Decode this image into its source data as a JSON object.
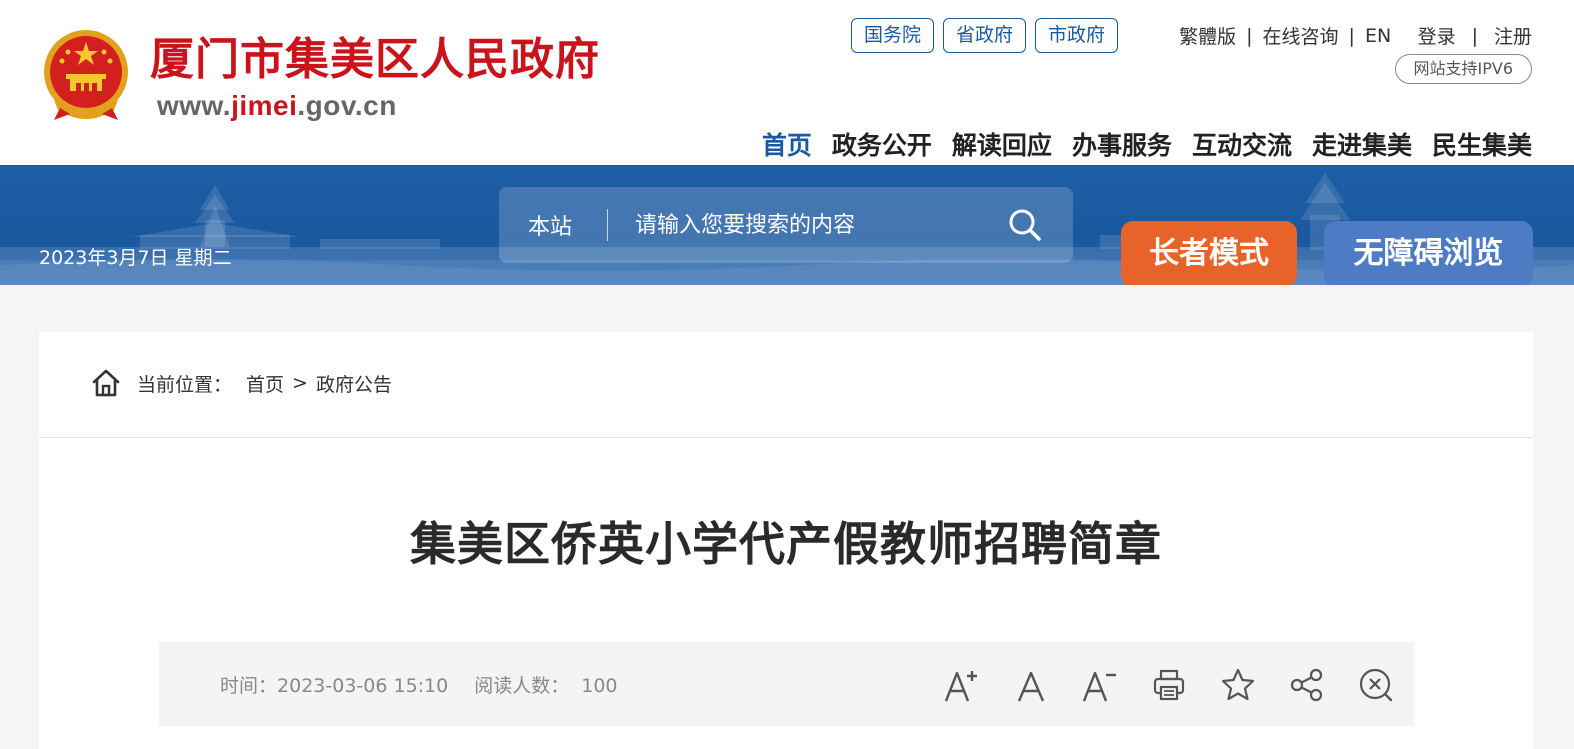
{
  "header": {
    "site_title": "厦门市集美区人民政府",
    "url": {
      "pre": "www.",
      "highlight": "jimei",
      "post": ".gov.cn"
    },
    "gov_links": [
      "国务院",
      "省政府",
      "市政府"
    ],
    "util_links": [
      "繁體版",
      "在线咨询",
      "EN",
      "登录",
      "注册"
    ],
    "ipv6_badge": "网站支持IPV6",
    "nav": [
      "首页",
      "政务公开",
      "解读回应",
      "办事服务",
      "互动交流",
      "走进集美",
      "民生集美"
    ]
  },
  "banner": {
    "date": "2023年3月7日 星期二",
    "search": {
      "scope": "本站",
      "placeholder": "请输入您要搜索的内容"
    },
    "elder_mode": "长者模式",
    "barrier_free": "无障碍浏览"
  },
  "breadcrumb": {
    "label": "当前位置：",
    "items": [
      "首页",
      "政府公告"
    ],
    "separator": ">"
  },
  "article": {
    "title": "集美区侨英小学代产假教师招聘简章",
    "time_label": "时间：",
    "time": "2023-03-06 15:10",
    "views_label": "阅读人数：",
    "views": "100"
  },
  "tools": [
    "font-larger-icon",
    "font-normal-icon",
    "font-smaller-icon",
    "print-icon",
    "favorite-icon",
    "share-icon",
    "close-icon"
  ],
  "colors": {
    "brand_red": "#c9141b",
    "brand_blue": "#1a5aa0",
    "banner": "#1f5ea6",
    "elder": "#e8632a",
    "barrier": "#4d7cc4"
  }
}
